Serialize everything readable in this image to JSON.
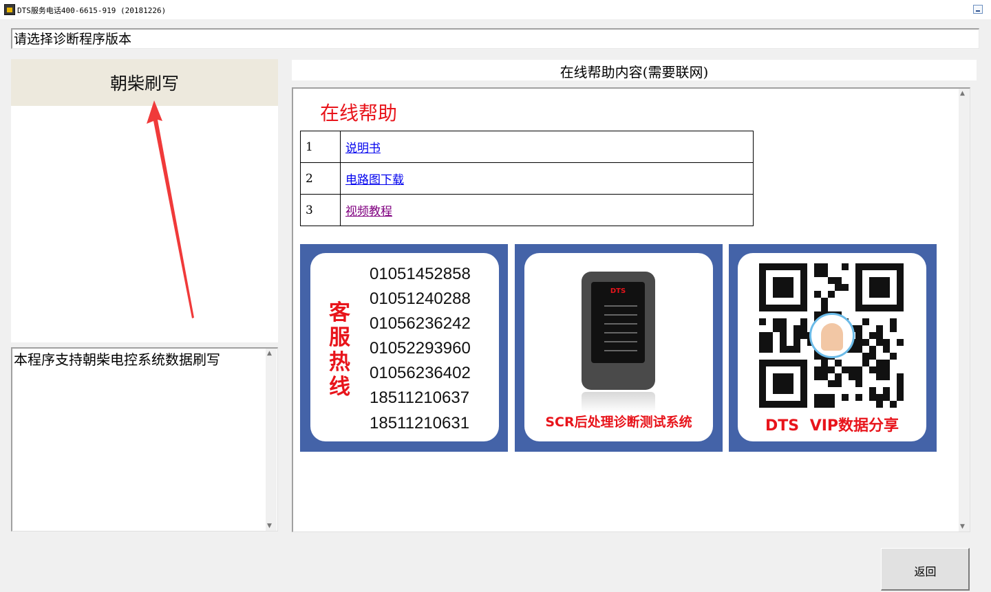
{
  "window": {
    "title": "DTS服务电话400-6615-919 (20181226)",
    "icon": "app-icon"
  },
  "header": {
    "version_prompt": "请选择诊断程序版本"
  },
  "program_list": {
    "items": [
      {
        "label": "朝柴刷写",
        "selected": true
      }
    ]
  },
  "description": {
    "text": "本程序支持朝柴电控系统数据刷写"
  },
  "help": {
    "header": "在线帮助内容(需要联网)",
    "title": "在线帮助",
    "rows": [
      {
        "num": "1",
        "label": "说明书"
      },
      {
        "num": "2",
        "label": "电路图下载"
      },
      {
        "num": "3",
        "label": "视频教程"
      }
    ]
  },
  "banners": {
    "hotline": {
      "title_chars": [
        "客",
        "服",
        "热",
        "线"
      ],
      "phones": [
        "01051452858",
        "01051240288",
        "01056236242",
        "01052293960",
        "01056236402",
        "18511210637",
        "18511210631"
      ]
    },
    "device": {
      "logo": "DTS",
      "caption": "SCR后处理诊断测试系统"
    },
    "vip": {
      "caption": "DTS VIP数据分享"
    }
  },
  "footer": {
    "back_label": "返回"
  },
  "colors": {
    "accent_red": "#e8141b",
    "banner_blue": "#4463a8",
    "link_blue": "#0000ee",
    "link_visited": "#800080",
    "selected_item_bg": "#ede9dd"
  }
}
